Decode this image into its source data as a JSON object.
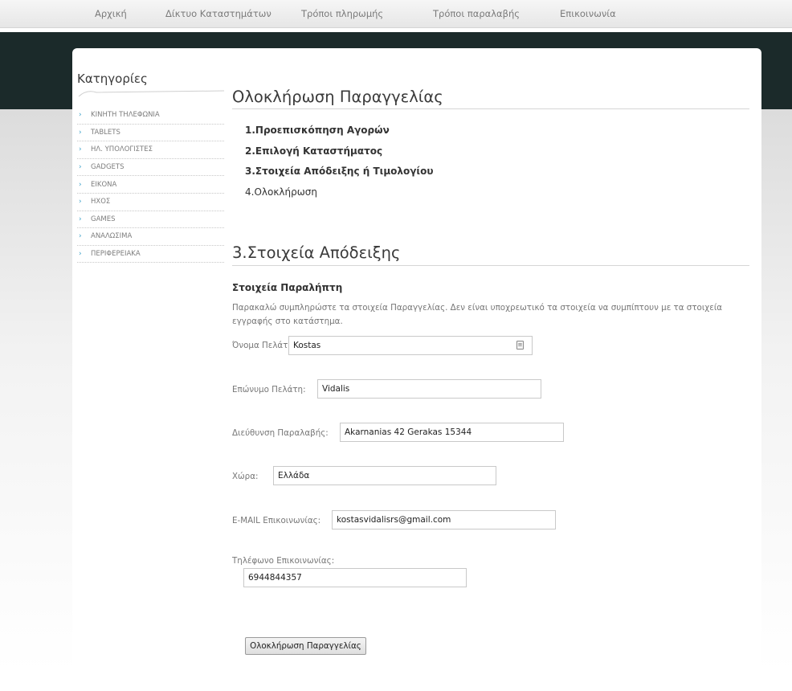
{
  "nav": {
    "items": [
      "Αρχική",
      "Δίκτυο Καταστημάτων",
      "Τρόποι πληρωμής",
      "Τρόποι παραλαβής",
      "Επικοινωνία"
    ]
  },
  "sidebar": {
    "title": "Κατηγορίες",
    "items": [
      "ΚΙΝΗΤΗ ΤΗΛΕΦΩΝΙΑ",
      "TABLETS",
      "ΗΛ. ΥΠΟΛΟΓΙΣΤΕΣ",
      "GADGETS",
      "ΕΙΚΟΝΑ",
      "ΗΧΟΣ",
      "GAMES",
      "ΑΝΑΛΩΣΙΜΑ",
      "ΠΕΡΙΦΕΡΕΙΑΚΑ"
    ]
  },
  "main": {
    "title": "Ολοκλήρωση Παραγγελίας",
    "steps": [
      {
        "label": "1.Προεπισκόπηση Αγορών"
      },
      {
        "label": "2.Επιλογή Καταστήματος"
      },
      {
        "label": "3.Στοιχεία Απόδειξης ή Τιμολογίου"
      },
      {
        "label": "4.Ολοκλήρωση"
      }
    ],
    "section_title": "3.Στοιχεία Απόδειξης",
    "subheading": "Στοιχεία Παραλήπτη",
    "intro": "Παρακαλώ συμπληρώστε τα στοιχεία Παραγγελίας. Δεν είναι υποχρεωτικό τα στοιχεία να συμπίπτουν με τα στοιχεία εγγραφής στο κατάστημα.",
    "fields": {
      "first_name": {
        "label": "Όνομα Πελάτη:",
        "value": "Kostas"
      },
      "last_name": {
        "label": "Επώνυμο Πελάτη:",
        "value": "Vidalis"
      },
      "address": {
        "label": "Διεύθυνση Παραλαβής:",
        "value": "Akarnanias 42 Gerakas 15344"
      },
      "country": {
        "label": "Χώρα:",
        "value": "Ελλάδα"
      },
      "email": {
        "label": "E-MAIL Επικοινωνίας:",
        "value": "kostasvidalisrs@gmail.com"
      },
      "phone": {
        "label": "Τηλέφωνο Επικοινωνίας:",
        "value": "6944844357"
      }
    },
    "submit_label": "Ολοκλήρωση Παραγγελίας"
  },
  "colors": {
    "dark_band": "#1b2a2a",
    "bullet": "#3aa0c8"
  }
}
